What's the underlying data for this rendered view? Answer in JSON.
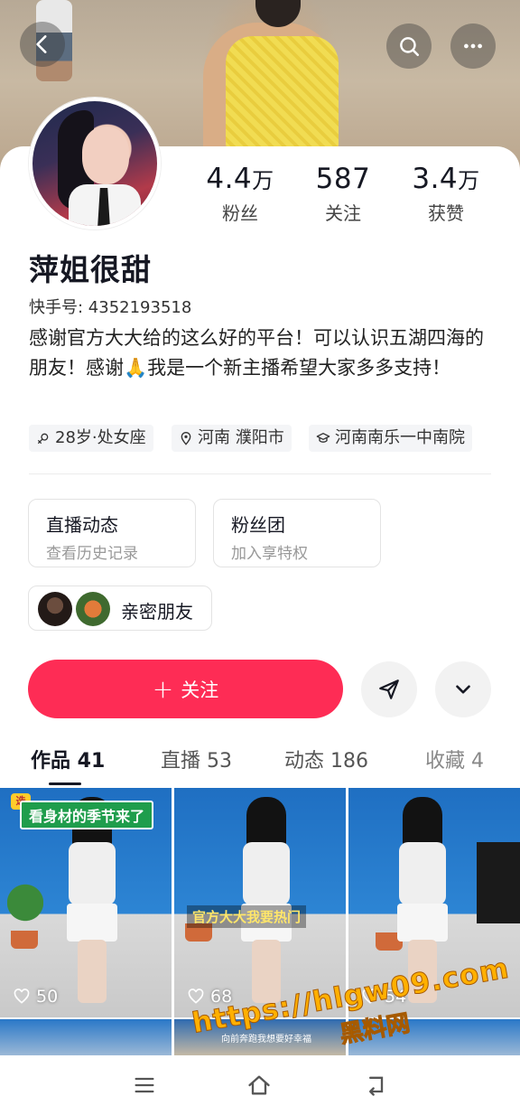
{
  "profile": {
    "nickname": "萍姐很甜",
    "kuaishou_id": "快手号: 4352193518",
    "bio": "感谢官方大大给的这么好的平台！可以认识五湖四海的朋友！感谢🙏我是一个新主播希望大家多多支持！"
  },
  "stats": [
    {
      "num": "4.4",
      "unit": "万",
      "label": "粉丝"
    },
    {
      "num": "587",
      "unit": "",
      "label": "关注"
    },
    {
      "num": "3.4",
      "unit": "万",
      "label": "获赞"
    }
  ],
  "tags": {
    "age": "28岁·处女座",
    "location": "河南 濮阳市",
    "school": "河南南乐一中南院"
  },
  "cards": {
    "live_title": "直播动态",
    "live_sub": "查看历史记录",
    "fans_title": "粉丝团",
    "fans_sub": "加入享特权",
    "friends": "亲密朋友"
  },
  "actions": {
    "follow_plus": "+",
    "follow": "关注"
  },
  "tabs": [
    {
      "label": "作品 41",
      "active": true
    },
    {
      "label": "直播 53",
      "active": false
    },
    {
      "label": "动态 186",
      "active": false
    },
    {
      "label": "收藏 4",
      "active": false
    }
  ],
  "works": [
    {
      "likes": "50",
      "caption": "看身材的季节来了",
      "badge": "选"
    },
    {
      "likes": "68",
      "caption": "官方大大我要热门"
    },
    {
      "likes": "54"
    }
  ],
  "row2_caption": "向前奔跑我想要好幸福",
  "watermark": {
    "url": "https://hlgw09.com",
    "cn": "黑料网"
  },
  "colors": {
    "accent": "#fe2c55",
    "text": "#161823",
    "watermark": "#ffb000"
  },
  "icons": [
    "back-icon",
    "search-icon",
    "more-icon",
    "send-icon",
    "chevron-down-icon",
    "heart-icon",
    "menu-icon",
    "home-icon",
    "return-icon"
  ]
}
